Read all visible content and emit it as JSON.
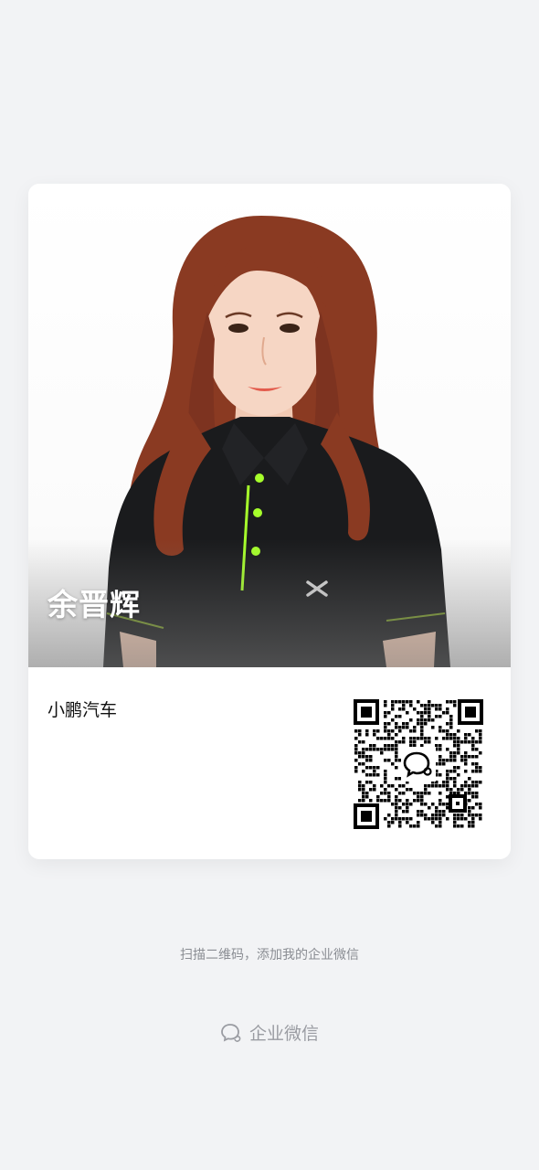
{
  "card": {
    "name": "余晋辉",
    "company": "小鹏汽车"
  },
  "qr": {
    "icon": "wecom-logo-icon"
  },
  "footer": {
    "hint": "扫描二维码，添加我的企业微信",
    "brand_label": "企业微信",
    "brand_icon": "wecom-logo-icon"
  },
  "colors": {
    "page_bg": "#f2f3f5",
    "card_bg": "#ffffff",
    "shirt": "#1a1b1d",
    "accent_green": "#a6ff2b",
    "hair": "#8a3a22"
  }
}
